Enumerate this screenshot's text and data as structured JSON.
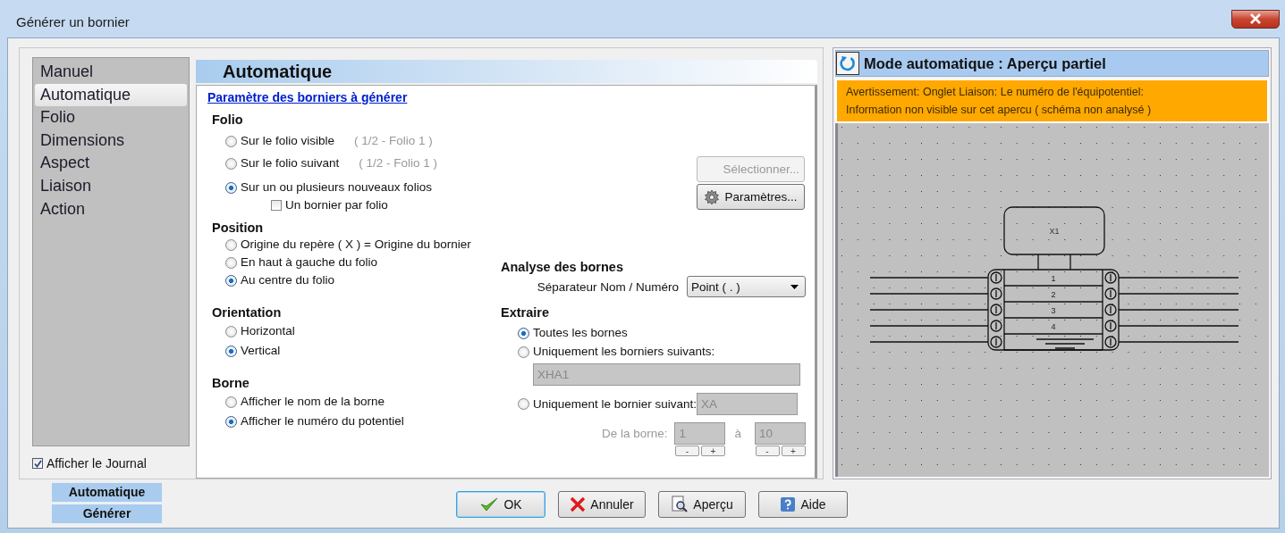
{
  "window": {
    "title": "Générer un bornier"
  },
  "sidebar": {
    "items": [
      {
        "label": "Manuel",
        "selected": false
      },
      {
        "label": "Automatique",
        "selected": true
      },
      {
        "label": "Folio",
        "selected": false
      },
      {
        "label": "Dimensions",
        "selected": false
      },
      {
        "label": "Aspect",
        "selected": false
      },
      {
        "label": "Liaison",
        "selected": false
      },
      {
        "label": "Action",
        "selected": false
      }
    ],
    "show_journal": {
      "label": "Afficher le Journal",
      "checked": true
    }
  },
  "bottom_tabs": [
    {
      "label": "Automatique"
    },
    {
      "label": "Générer"
    }
  ],
  "panel": {
    "title": "Automatique",
    "link": "Paramètre des borniers à générer",
    "folio": {
      "heading": "Folio",
      "options": [
        {
          "label": "Sur le folio visible",
          "note": "( 1/2 - Folio 1 )",
          "selected": false
        },
        {
          "label": "Sur le folio suivant",
          "note": "( 1/2 - Folio 1 )",
          "selected": false
        },
        {
          "label": "Sur un ou plusieurs nouveaux folios",
          "selected": true
        }
      ],
      "one_per_folio": {
        "label": "Un bornier par folio",
        "checked": false
      }
    },
    "select_button": {
      "label": "Sélectionner...",
      "disabled": true
    },
    "params_button": {
      "label": "Paramètres..."
    },
    "position": {
      "heading": "Position",
      "options": [
        {
          "label": "Origine du repère ( X ) = Origine du bornier",
          "selected": false
        },
        {
          "label": "En haut à gauche du folio",
          "selected": false
        },
        {
          "label": "Au centre du folio",
          "selected": true
        }
      ]
    },
    "orientation": {
      "heading": "Orientation",
      "options": [
        {
          "label": "Horizontal",
          "selected": false
        },
        {
          "label": "Vertical",
          "selected": true
        }
      ]
    },
    "borne": {
      "heading": "Borne",
      "options": [
        {
          "label": "Afficher le nom de la borne",
          "selected": false
        },
        {
          "label": "Afficher le numéro du potentiel",
          "selected": true
        }
      ]
    },
    "analysis": {
      "heading": "Analyse des bornes",
      "separator_label": "Séparateur Nom / Numéro",
      "separator_value": "Point (  .  )"
    },
    "extract": {
      "heading": "Extraire",
      "options": [
        {
          "label": "Toutes les bornes",
          "selected": true
        },
        {
          "label": "Uniquement les borniers suivants:",
          "selected": false,
          "field": "XHA1",
          "field_disabled": true
        },
        {
          "label": "Uniquement le bornier suivant:",
          "selected": false,
          "field": "XA",
          "field_disabled": true
        }
      ],
      "range": {
        "label": "De la borne:",
        "to_label": "à",
        "disabled": true,
        "from": {
          "value": "1",
          "minus": "-",
          "plus": "+"
        },
        "to": {
          "value": "10",
          "minus": "-",
          "plus": "+"
        }
      }
    }
  },
  "preview": {
    "title": "Mode automatique : Aperçu partiel",
    "warning": [
      "Avertissement: Onglet Liaison: Le numéro de l'équipotentiel:",
      "Information non visible sur cet apercu ( schéma non analysé )"
    ],
    "diagram": {
      "block": "X1",
      "terminals": [
        "1",
        "2",
        "3",
        "4"
      ]
    }
  },
  "buttons": [
    {
      "label": "OK",
      "kind": "ok",
      "default": true
    },
    {
      "label": "Annuler",
      "kind": "cancel",
      "default": false
    },
    {
      "label": "Aperçu",
      "kind": "preview",
      "default": false
    },
    {
      "label": "Aide",
      "kind": "help",
      "default": false
    }
  ]
}
